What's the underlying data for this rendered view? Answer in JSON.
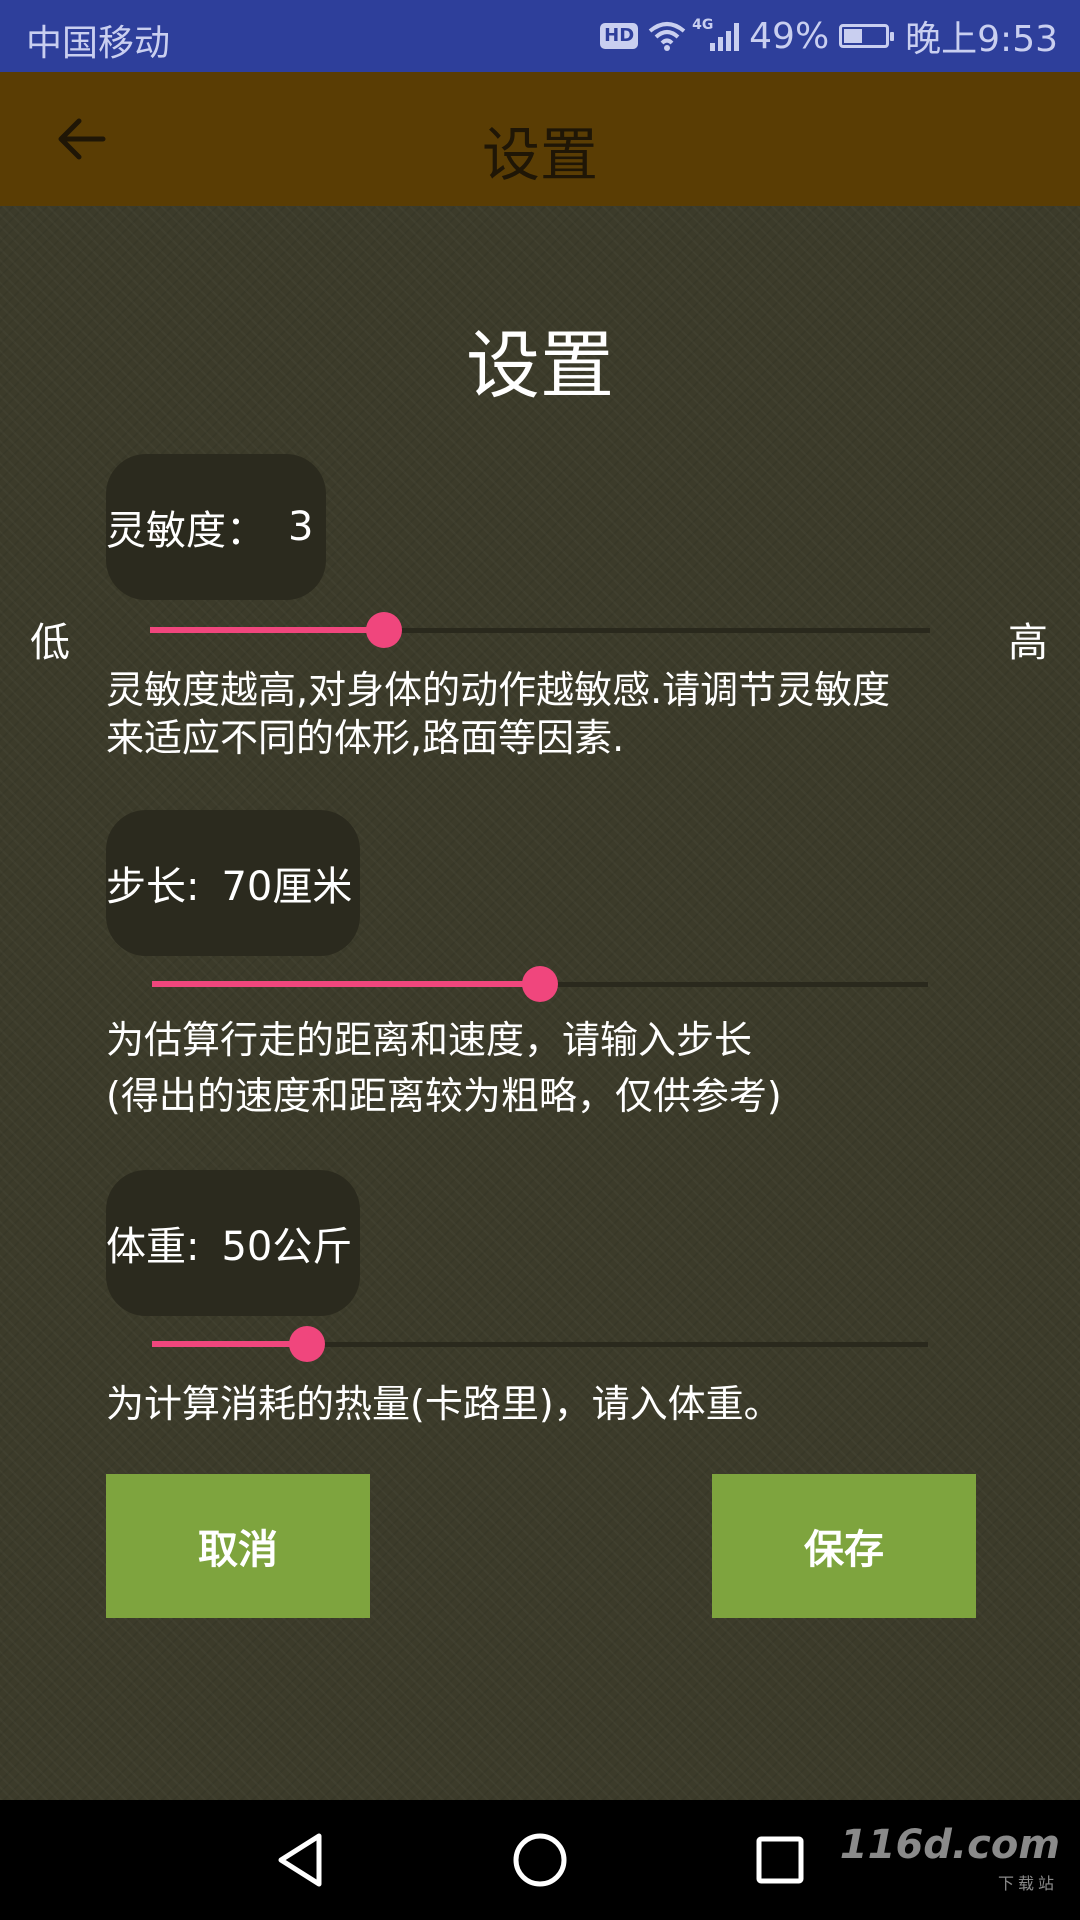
{
  "status_bar": {
    "carrier": "中国移动",
    "hd": "HD",
    "network": "4G",
    "battery": "49%",
    "battery_level": 0.49,
    "time": "晚上9:53",
    "color": "#2e3f9b"
  },
  "app_bar": {
    "title": "设置",
    "back_icon": "arrow-left-icon",
    "color": "#5a3d04"
  },
  "heading": "设置",
  "sensitivity": {
    "label": "灵敏度：",
    "value": "3",
    "low_label": "低",
    "high_label": "高",
    "fraction": 0.3,
    "description_line1": "灵敏度越高,对身体的动作越敏感.请调节灵敏度",
    "description_line2": "来适应不同的体形,路面等因素."
  },
  "stride": {
    "label": "步长:",
    "value": "70厘米",
    "fraction": 0.5,
    "description_line1": "为估算行走的距离和速度，请输入步长",
    "description_line2": "(得出的速度和距离较为粗略，仅供参考)"
  },
  "weight": {
    "label": "体重:",
    "value": "50公斤",
    "fraction": 0.2,
    "description": "为计算消耗的热量(卡路里)，请入体重。"
  },
  "buttons": {
    "cancel": "取消",
    "save": "保存",
    "color": "#7ea43e"
  },
  "accent": "#f0467d",
  "nav_bar": {
    "back_icon": "triangle-back-icon",
    "home_icon": "circle-home-icon",
    "recents_icon": "square-recents-icon"
  },
  "watermark": {
    "text": "116d.com",
    "sub": "下载站"
  }
}
